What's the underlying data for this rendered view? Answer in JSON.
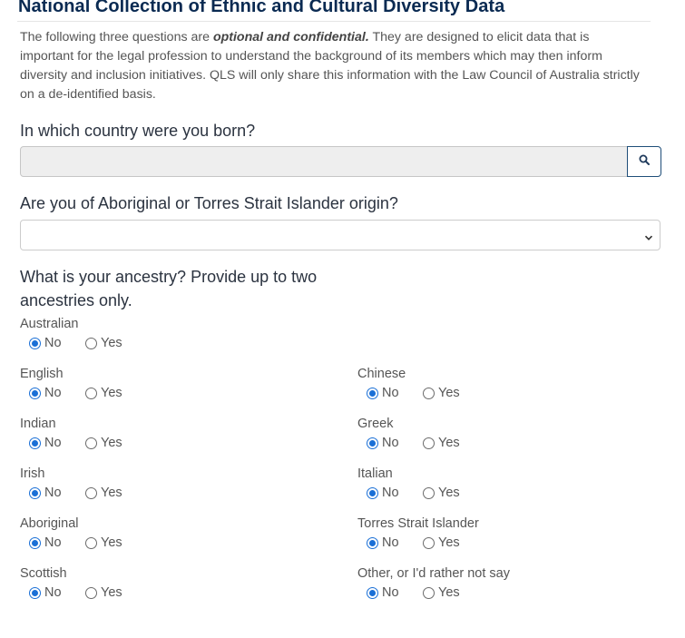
{
  "section": {
    "title": "National Collection of Ethnic and Cultural Diversity Data",
    "intro_before": "The following three questions are ",
    "intro_emphasis": "optional and confidential.",
    "intro_after": " They are designed to elicit data that is important for the legal profession to understand the background of its members which may then inform diversity and inclusion initiatives. QLS will only share this information with the Law Council of Australia strictly on a de-identified basis."
  },
  "questions": {
    "country": {
      "label": "In which country were you born?",
      "value": "",
      "search_icon": "search-icon"
    },
    "aboriginal": {
      "label": "Are you of Aboriginal or Torres Strait Islander origin?",
      "selected": ""
    },
    "ancestry": {
      "label": "What is your ancestry? Provide up to two ancestries only."
    }
  },
  "ancestry_fields": [
    {
      "label": "Australian",
      "selected": "No"
    },
    {
      "label": "English",
      "selected": "No"
    },
    {
      "label": "Chinese",
      "selected": "No"
    },
    {
      "label": "Indian",
      "selected": "No"
    },
    {
      "label": "Greek",
      "selected": "No"
    },
    {
      "label": "Irish",
      "selected": "No"
    },
    {
      "label": "Italian",
      "selected": "No"
    },
    {
      "label": "Aboriginal",
      "selected": "No"
    },
    {
      "label": "Torres Strait Islander",
      "selected": "No"
    },
    {
      "label": "Scottish",
      "selected": "No"
    },
    {
      "label": "Other, or I'd rather not say",
      "selected": "No"
    }
  ],
  "option_labels": {
    "no": "No",
    "yes": "Yes"
  },
  "colors": {
    "title": "#0a2a52",
    "radio_checked": "#1a6fd6",
    "button_border": "#1f4e79"
  }
}
